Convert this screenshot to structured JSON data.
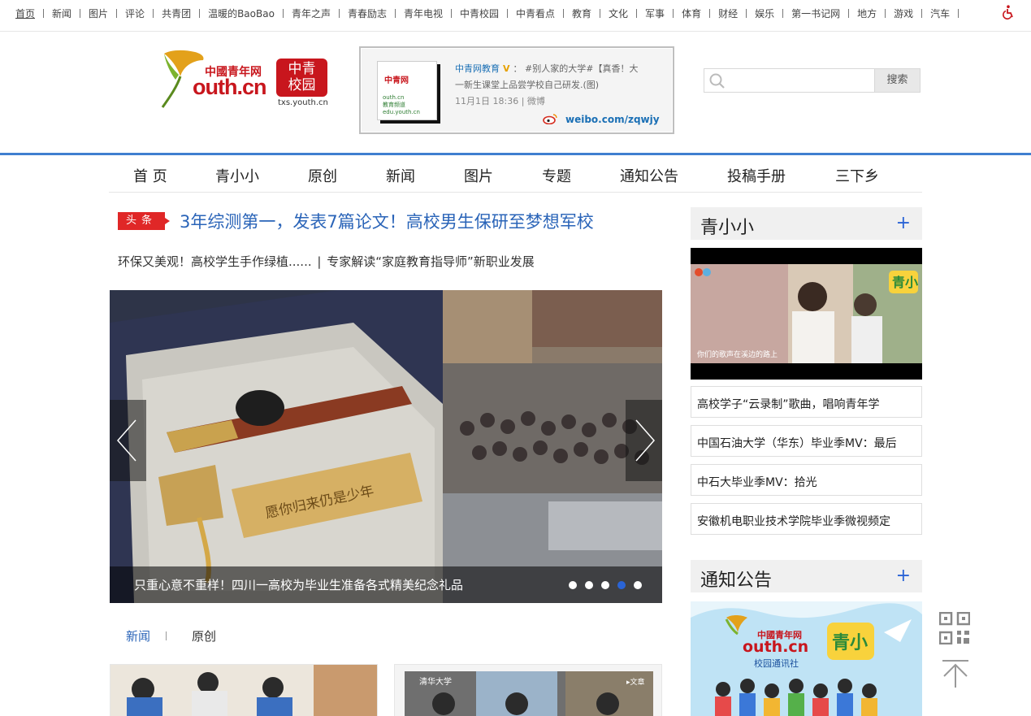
{
  "top_nav": [
    "首页",
    "新闻",
    "图片",
    "评论",
    "共青团",
    "温暖的BaoBao",
    "青年之声",
    "青春励志",
    "青年电视",
    "中青校园",
    "中青看点",
    "教育",
    "文化",
    "军事",
    "体育",
    "财经",
    "娱乐",
    "第一书记网",
    "地方",
    "游戏",
    "汽车"
  ],
  "logo": {
    "cn_text": "中國青年网",
    "en_text": "outh.cn",
    "badge_line1": "中青",
    "badge_line2": "校园",
    "domain": "txs.youth.cn"
  },
  "weibo": {
    "account": "中青网教育",
    "v_mark": "V",
    "colon": "：",
    "post": "#别人家的大学#【真香！大一新生课堂上品尝学校自己研发.(图)",
    "time": "11月1日 18:36",
    "source": "微博",
    "link": "weibo.com/zqwjy",
    "thumb_cn": "中青网",
    "thumb_en": "outh.cn",
    "thumb_line1": "教育频道",
    "thumb_line2": "edu.youth.cn"
  },
  "search": {
    "placeholder": "",
    "button": "搜索"
  },
  "main_nav": [
    "首 页",
    "青小小",
    "原创",
    "新闻",
    "图片",
    "专题",
    "通知公告",
    "投稿手册",
    "三下乡"
  ],
  "headline": {
    "tag": "头条",
    "title": "3年综测第一，发表7篇论文！高校男生保研至梦想军校"
  },
  "subline": {
    "left": "环保又美观！高校学生手作绿植......",
    "sep": "|",
    "right": "专家解读“家庭教育指导师”新职业发展"
  },
  "slider": {
    "caption": "只重心意不重样！四川一高校为毕业生准备各式精美纪念礼品",
    "engraving": "愿你归来仍是少年",
    "dots": 5,
    "active_dot": 4
  },
  "subtabs": [
    "新闻",
    "原创"
  ],
  "sidebar": {
    "section1": {
      "title": "青小小",
      "plus": "+"
    },
    "video_logo": "青小",
    "video_subtitle": "你们的歌声在溪边的路上",
    "videos": [
      "高校学子“云录制”歌曲，唱响青年学",
      "中国石油大学（华东）毕业季MV：最后",
      "中石大毕业季MV：拾光",
      "安徽机电职业技术学院毕业季微视频定"
    ],
    "section2": {
      "title": "通知公告",
      "plus": "+"
    },
    "notice_banner": {
      "cn": "中國青年网",
      "en": "outh.cn",
      "sub": "校园通讯社",
      "logo": "青小"
    }
  },
  "cards": {
    "b_label": "清华大学",
    "b_badge": "▸文章"
  },
  "icons": {
    "accent": "#2a64d6",
    "headline_red": "#e02727",
    "brand_red": "#c8161d"
  }
}
